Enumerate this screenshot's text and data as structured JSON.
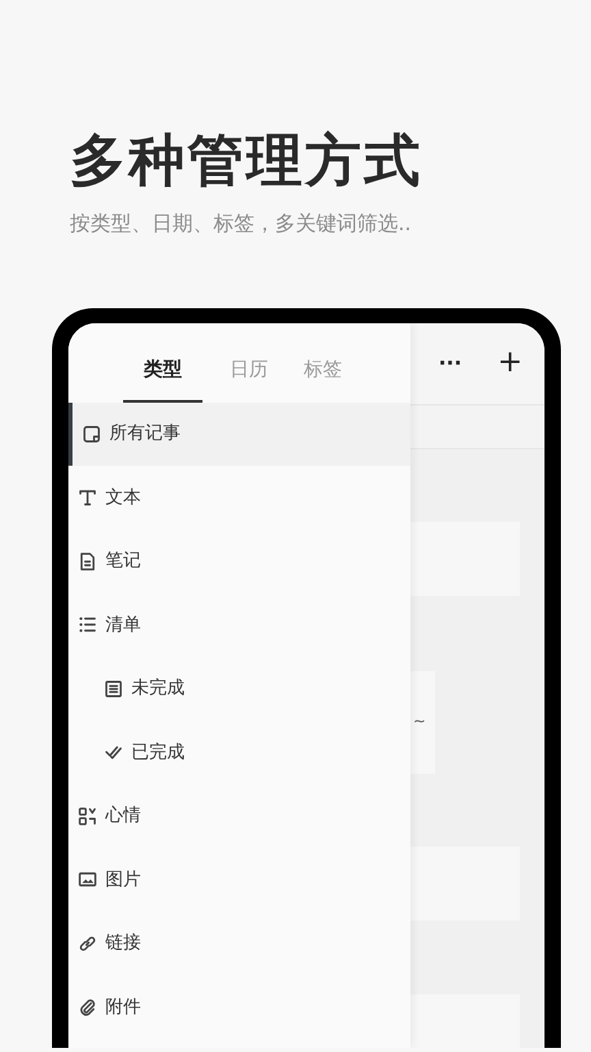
{
  "headline": "多种管理方式",
  "subtitle": "按类型、日期、标签，多关键词筛选..",
  "drawer": {
    "tabs": [
      {
        "label": "类型",
        "selected": true
      },
      {
        "label": "日历",
        "selected": false
      },
      {
        "label": "标签",
        "selected": false
      }
    ],
    "items": [
      {
        "label": "所有记事",
        "kind": "note",
        "selected": true
      },
      {
        "label": "文本",
        "kind": "text",
        "selected": false
      },
      {
        "label": "笔记",
        "kind": "doc",
        "selected": false
      },
      {
        "label": "清单",
        "kind": "list",
        "selected": false,
        "children": [
          {
            "label": "未完成",
            "kind": "todo",
            "selected": false
          },
          {
            "label": "已完成",
            "kind": "done",
            "selected": false
          }
        ]
      },
      {
        "label": "心情",
        "kind": "mood",
        "selected": false
      },
      {
        "label": "图片",
        "kind": "image",
        "selected": false
      },
      {
        "label": "链接",
        "kind": "link",
        "selected": false
      },
      {
        "label": "附件",
        "kind": "clip",
        "selected": false
      }
    ]
  },
  "toolbar": {
    "more": "···",
    "add": "+"
  },
  "background_cards": [
    {
      "kind": "blank"
    },
    {
      "kind": "snippet",
      "text": "~"
    },
    {
      "kind": "blank"
    },
    {
      "kind": "blank"
    }
  ]
}
